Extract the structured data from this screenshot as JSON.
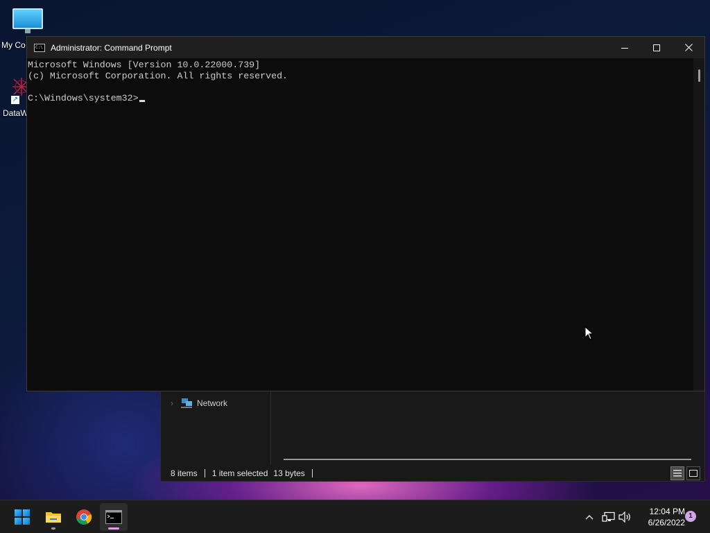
{
  "desktop": {
    "icons": [
      {
        "label": "My Co",
        "icon": "computer-icon"
      },
      {
        "label": "DataW",
        "icon": "datawrangler-icon"
      }
    ]
  },
  "cmd": {
    "title": "Administrator: Command Prompt",
    "lines": [
      "Microsoft Windows [Version 10.0.22000.739]",
      "(c) Microsoft Corporation. All rights reserved.",
      "",
      "C:\\Windows\\system32>"
    ],
    "controls": {
      "minimize": "—",
      "maximize": "☐",
      "close": "✕"
    }
  },
  "explorer": {
    "nav_item": "Network",
    "status": {
      "items": "8 items",
      "selected": "1 item selected",
      "size": "13 bytes"
    }
  },
  "taskbar": {
    "apps": [
      "start",
      "file-explorer",
      "chrome",
      "command-prompt"
    ],
    "active": "command-prompt",
    "clock": {
      "time": "12:04 PM",
      "date": "6/26/2022"
    },
    "notification_count": "1"
  }
}
